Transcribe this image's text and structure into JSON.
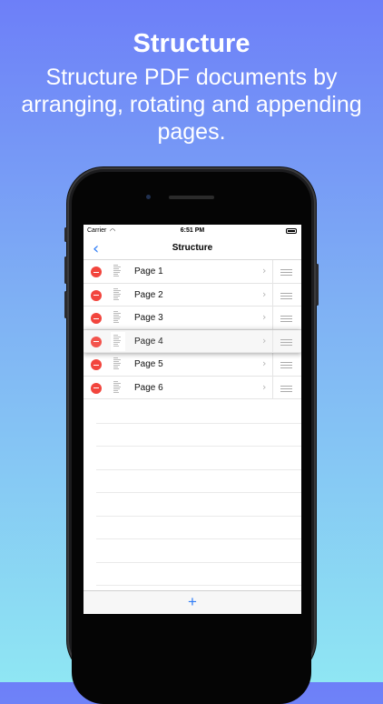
{
  "header": {
    "title": "Structure",
    "subtitle": "Structure PDF documents by arranging, rotating and appending pages."
  },
  "status_bar": {
    "carrier": "Carrier",
    "time": "6:51 PM"
  },
  "nav": {
    "back_icon": "chevron-left-icon",
    "title": "Structure"
  },
  "pages": [
    {
      "label": "Page 1",
      "dragging": false
    },
    {
      "label": "Page 2",
      "dragging": false
    },
    {
      "label": "Page 3",
      "dragging": false
    },
    {
      "label": "Page 4",
      "dragging": true
    },
    {
      "label": "Page 5",
      "dragging": false
    },
    {
      "label": "Page 6",
      "dragging": false
    }
  ],
  "toolbar": {
    "add_label": "+"
  },
  "colors": {
    "accent": "#2f7cf6",
    "delete": "#f2453d",
    "bg_top": "#6d7ff8",
    "bg_bottom": "#8fe6f3"
  }
}
